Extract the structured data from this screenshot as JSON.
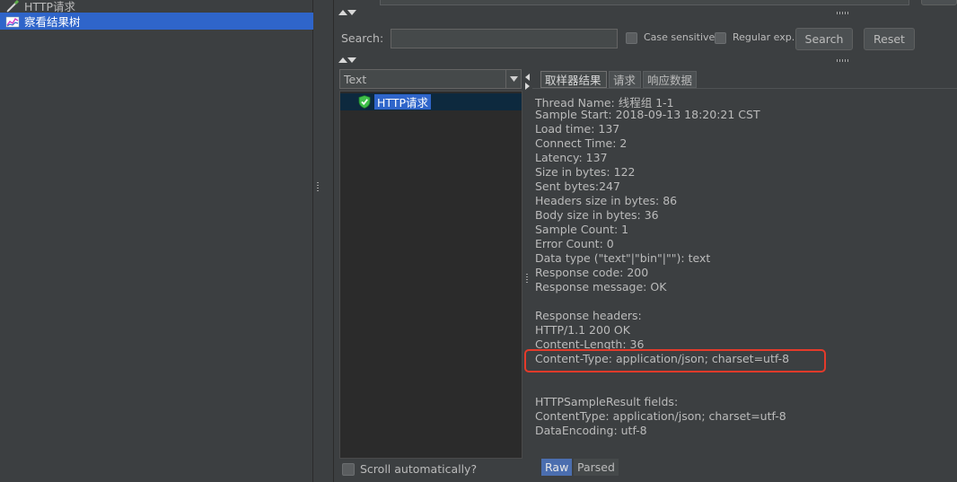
{
  "tree": {
    "items": [
      {
        "label": "HTTP请求",
        "icon": "pipette-icon"
      },
      {
        "label": "察看结果树",
        "icon": "chart-icon",
        "selected": true
      }
    ]
  },
  "search": {
    "label": "Search:",
    "value": "",
    "case_sensitive": "Case sensitive",
    "regexp": "Regular exp.",
    "search_button": "Search",
    "reset_button": "Reset"
  },
  "renderer": {
    "selected": "Text"
  },
  "results": {
    "item": "HTTP请求",
    "scroll_auto": "Scroll automatically?"
  },
  "tabs": [
    "取样器结果",
    "请求",
    "响应数据"
  ],
  "sampler_result": [
    "Thread Name: 线程组 1-1",
    "Sample Start: 2018-09-13 18:20:21 CST",
    "Load time: 137",
    "Connect Time: 2",
    "Latency: 137",
    "Size in bytes: 122",
    "Sent bytes:247",
    "Headers size in bytes: 86",
    "Body size in bytes: 36",
    "Sample Count: 1",
    "Error Count: 0",
    "Data type (\"text\"|\"bin\"|\"\"): text",
    "Response code: 200",
    "Response message: OK",
    "",
    "Response headers:",
    "HTTP/1.1 200 OK",
    "Content-Length: 36",
    "Content-Type: application/json; charset=utf-8",
    "",
    "",
    "HTTPSampleResult fields:",
    "ContentType: application/json; charset=utf-8",
    "DataEncoding: utf-8"
  ],
  "bottom_tabs": {
    "raw": "Raw",
    "parsed": "Parsed"
  },
  "colors": {
    "selection": "#2f65ca",
    "highlight": "#e53a2a",
    "success": "#3fbf4a"
  }
}
